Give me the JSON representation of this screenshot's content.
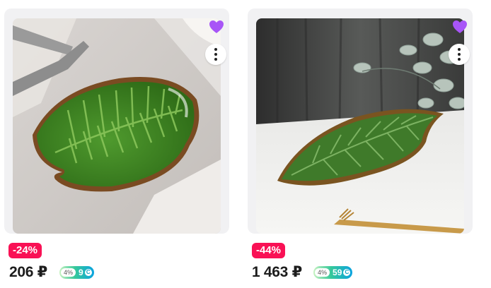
{
  "products": [
    {
      "image_alt": "Green leaf-shaped ceramic bowl with forks",
      "discount": "-24%",
      "price": "206 ₽",
      "cashback_percent": "4%",
      "cashback_points": "9",
      "coin_symbol": "C"
    },
    {
      "image_alt": "Green leaf-shaped ceramic dish on white table",
      "discount": "-44%",
      "price": "1 463 ₽",
      "cashback_percent": "4%",
      "cashback_points": "59",
      "coin_symbol": "C"
    }
  ],
  "colors": {
    "discount_badge": "#f91155",
    "favorite_heart": "#a855f7",
    "card_bg": "#f1f1f3"
  },
  "icons": {
    "favorite": "heart-icon",
    "more": "more-vertical-icon",
    "cashback_coin": "coin-icon"
  }
}
